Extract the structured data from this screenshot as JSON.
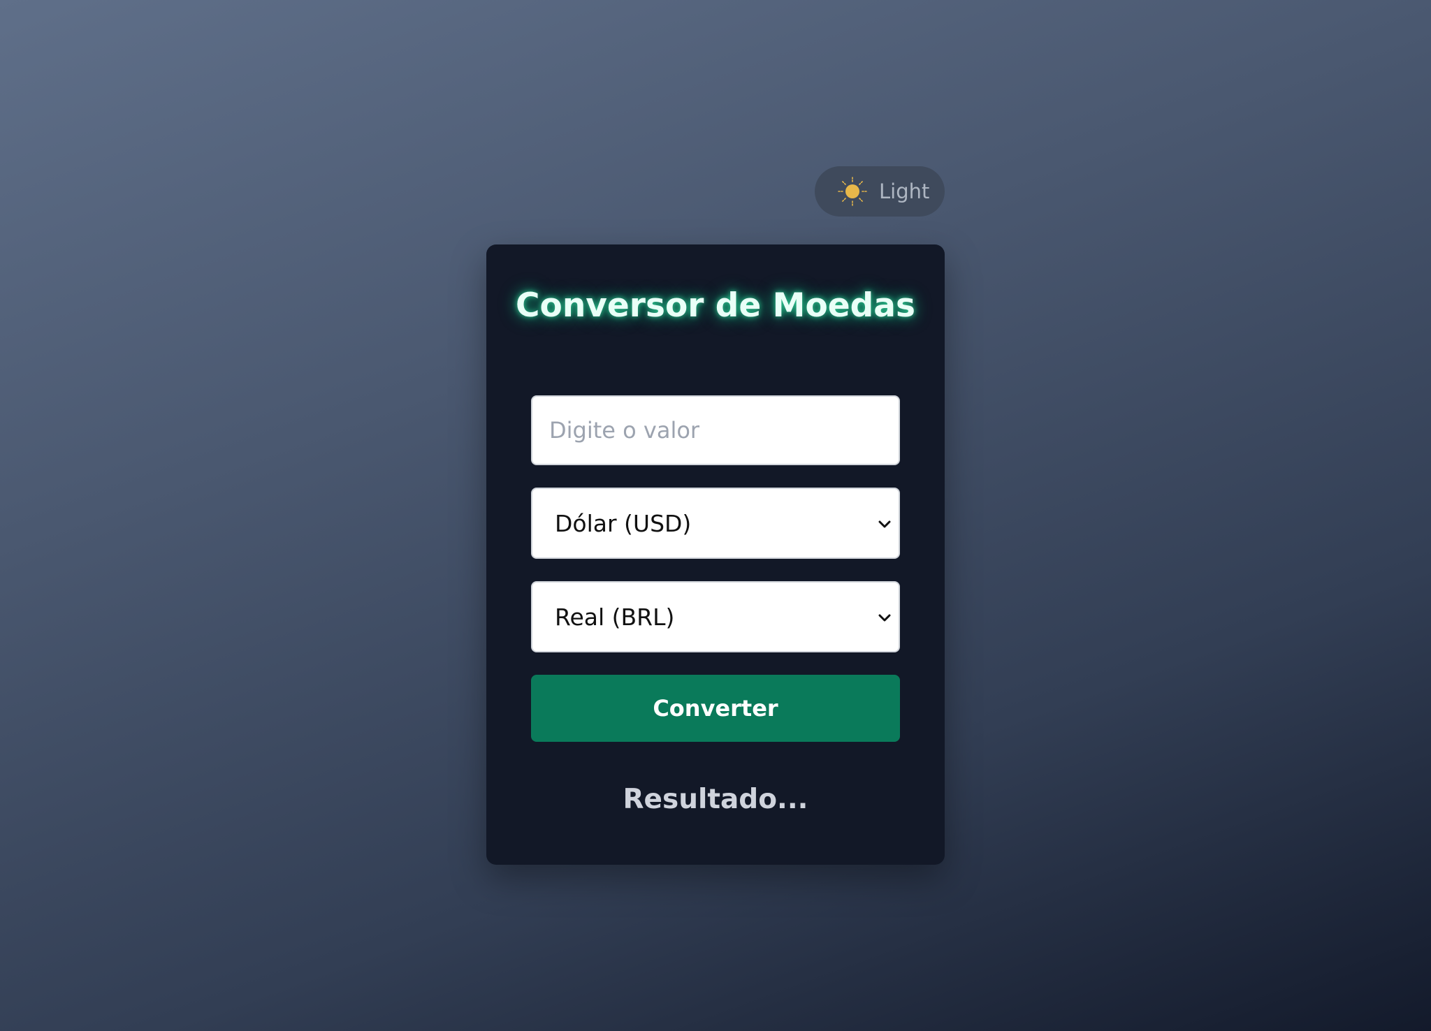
{
  "theme_toggle": {
    "label": "Light",
    "icon": "sun-icon",
    "icon_color": "#e8b84a"
  },
  "converter": {
    "title": "Conversor de Moedas",
    "amount_placeholder": "Digite o valor",
    "amount_value": "",
    "from_currency": "Dólar (USD)",
    "to_currency": "Real (BRL)",
    "convert_label": "Converter",
    "result_text": "Resultado..."
  },
  "colors": {
    "accent": "#0a7a5a",
    "title_glow": "#10b981",
    "card_background": "#121827"
  }
}
